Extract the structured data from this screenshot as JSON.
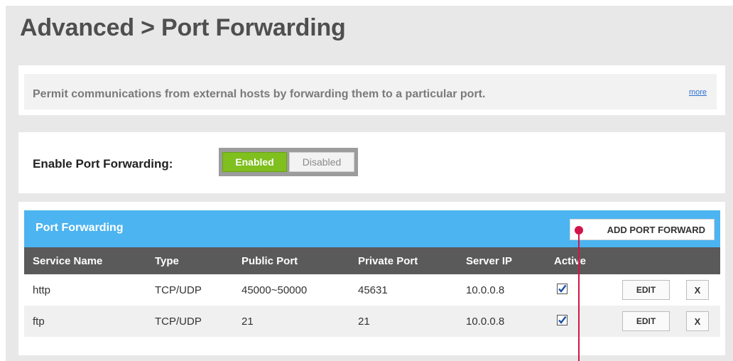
{
  "page": {
    "title": "Advanced > Port Forwarding"
  },
  "description": {
    "text": "Permit communications from external hosts by forwarding them to a particular port.",
    "more_link": "more"
  },
  "enable": {
    "label": "Enable Port Forwarding:",
    "enabled_label": "Enabled",
    "disabled_label": "Disabled",
    "state": "Enabled"
  },
  "port_forwarding": {
    "title": "Port Forwarding",
    "add_button": "ADD PORT FORWARD",
    "columns": [
      "Service Name",
      "Type",
      "Public Port",
      "Private Port",
      "Server IP",
      "Active"
    ],
    "rows": [
      {
        "service": "http",
        "type": "TCP/UDP",
        "public_port": "45000~50000",
        "private_port": "45631",
        "server_ip": "10.0.0.8",
        "active": true,
        "edit": "EDIT",
        "delete": "X"
      },
      {
        "service": "ftp",
        "type": "TCP/UDP",
        "public_port": "21",
        "private_port": "21",
        "server_ip": "10.0.0.8",
        "active": true,
        "edit": "EDIT",
        "delete": "X"
      }
    ]
  },
  "colors": {
    "header_blue": "#4cb4f0",
    "enabled_green": "#7fbf1e",
    "annotation_red": "#d3144a",
    "table_header": "#5a5a5a"
  }
}
